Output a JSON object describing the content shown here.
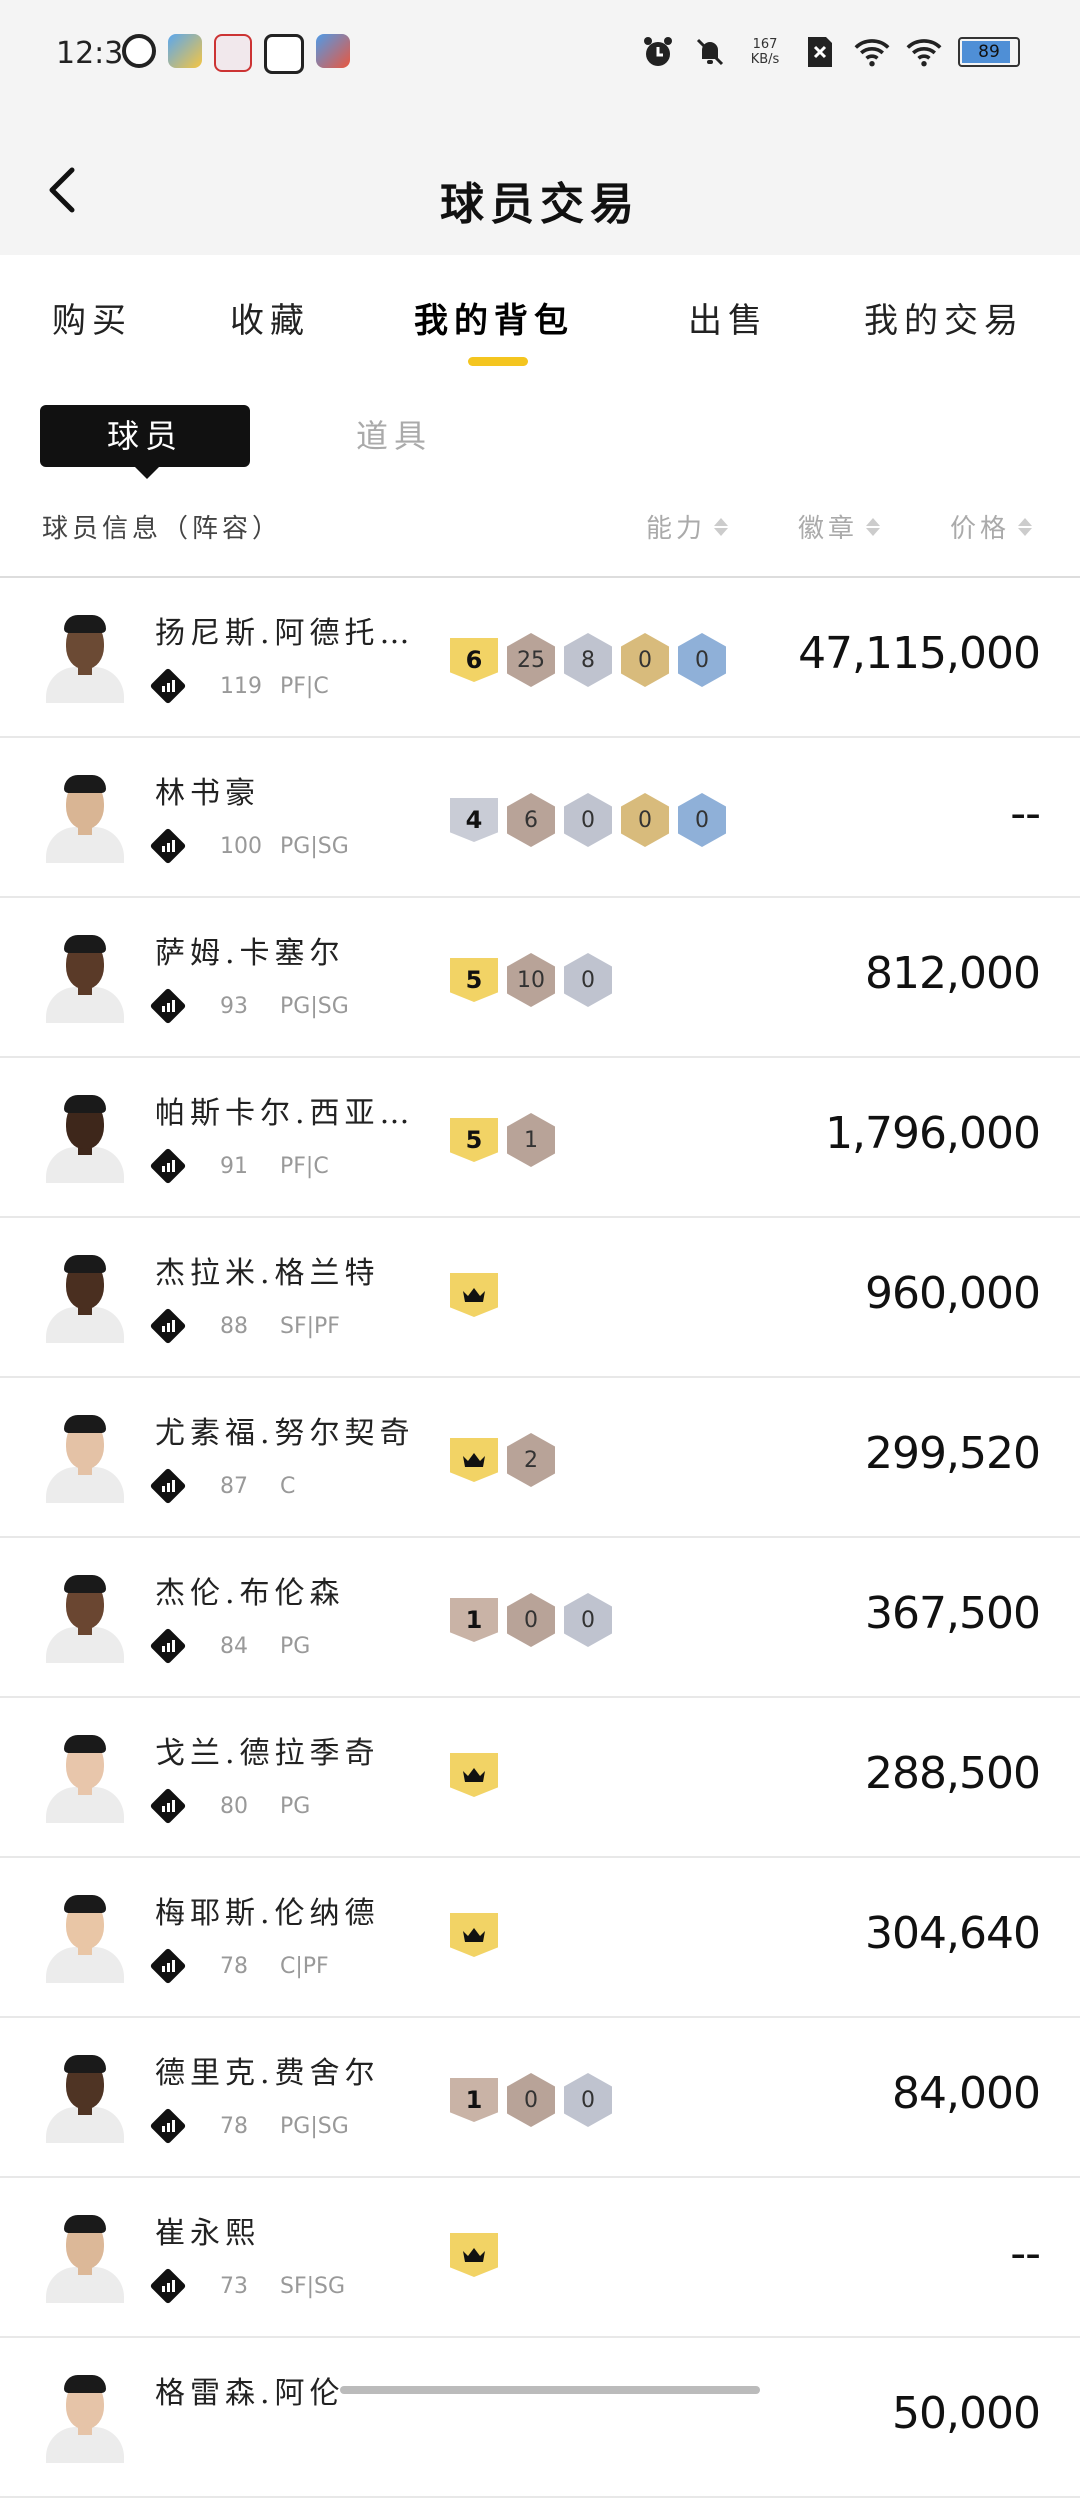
{
  "status_bar": {
    "time": "12:31",
    "net_speed_value": "167",
    "net_speed_unit": "KB/s",
    "battery": "89"
  },
  "header": {
    "title": "球员交易"
  },
  "tabs": [
    {
      "label": "购买"
    },
    {
      "label": "收藏"
    },
    {
      "label": "我的背包"
    },
    {
      "label": "出售"
    },
    {
      "label": "我的交易"
    }
  ],
  "subtabs": {
    "players": "球员",
    "items": "道具"
  },
  "columns": {
    "info": "球员信息（阵容）",
    "ability": "能力",
    "badge": "徽章",
    "price": "价格"
  },
  "players": [
    {
      "name": "扬尼斯.阿德托…",
      "rating": "119",
      "position": "PF|C",
      "skin": "#6b4a34",
      "price": "47,115,000",
      "shield": {
        "text": "6",
        "tone": "gold"
      },
      "hexes": [
        {
          "text": "25",
          "tone": "bronze"
        },
        {
          "text": "8",
          "tone": "silver"
        },
        {
          "text": "0",
          "tone": "gold"
        },
        {
          "text": "0",
          "tone": "blue"
        }
      ]
    },
    {
      "name": "林书豪",
      "rating": "100",
      "position": "PG|SG",
      "skin": "#d9b594",
      "price": "--",
      "shield": {
        "text": "4",
        "tone": "silver"
      },
      "hexes": [
        {
          "text": "6",
          "tone": "bronze"
        },
        {
          "text": "0",
          "tone": "silver"
        },
        {
          "text": "0",
          "tone": "gold"
        },
        {
          "text": "0",
          "tone": "blue"
        }
      ]
    },
    {
      "name": "萨姆.卡塞尔",
      "rating": "93",
      "position": "PG|SG",
      "skin": "#5a3a28",
      "price": "812,000",
      "shield": {
        "text": "5",
        "tone": "gold"
      },
      "hexes": [
        {
          "text": "10",
          "tone": "bronze"
        },
        {
          "text": "0",
          "tone": "silver"
        }
      ]
    },
    {
      "name": "帕斯卡尔.西亚…",
      "rating": "91",
      "position": "PF|C",
      "skin": "#3e271b",
      "price": "1,796,000",
      "shield": {
        "text": "5",
        "tone": "gold"
      },
      "hexes": [
        {
          "text": "1",
          "tone": "bronze"
        }
      ]
    },
    {
      "name": "杰拉米.格兰特",
      "rating": "88",
      "position": "SF|PF",
      "skin": "#4a2f20",
      "price": "960,000",
      "crown": true,
      "hexes": []
    },
    {
      "name": "尤素福.努尔契奇",
      "rating": "87",
      "position": "C",
      "skin": "#e4c2a6",
      "price": "299,520",
      "crown": true,
      "hexes": [
        {
          "text": "2",
          "tone": "bronze"
        }
      ]
    },
    {
      "name": "杰伦.布伦森",
      "rating": "84",
      "position": "PG",
      "skin": "#6a4631",
      "price": "367,500",
      "shield": {
        "text": "1",
        "tone": "bronze"
      },
      "hexes": [
        {
          "text": "0",
          "tone": "bronze"
        },
        {
          "text": "0",
          "tone": "silver"
        }
      ]
    },
    {
      "name": "戈兰.德拉季奇",
      "rating": "80",
      "position": "PG",
      "skin": "#e8c6ab",
      "price": "288,500",
      "crown": true,
      "hexes": []
    },
    {
      "name": "梅耶斯.伦纳德",
      "rating": "78",
      "position": "C|PF",
      "skin": "#e9c6a6",
      "price": "304,640",
      "crown": true,
      "hexes": []
    },
    {
      "name": "德里克.费舍尔",
      "rating": "78",
      "position": "PG|SG",
      "skin": "#4f3424",
      "price": "84,000",
      "shield": {
        "text": "1",
        "tone": "bronze"
      },
      "hexes": [
        {
          "text": "0",
          "tone": "bronze"
        },
        {
          "text": "0",
          "tone": "silver"
        }
      ]
    },
    {
      "name": "崔永熙",
      "rating": "73",
      "position": "SF|SG",
      "skin": "#dcb898",
      "price": "--",
      "crown": true,
      "hexes": []
    },
    {
      "name": "格雷森.阿伦",
      "rating": "",
      "position": "",
      "skin": "#e6c4a8",
      "price": "50,000",
      "crown": false,
      "hexes": []
    }
  ]
}
